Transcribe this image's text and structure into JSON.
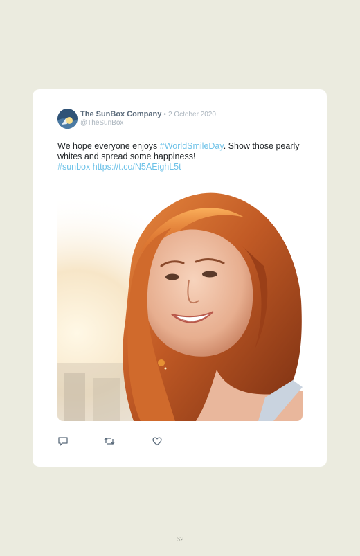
{
  "tweet": {
    "author_name": "The SunBox Company",
    "separator": "•",
    "date": "2 October 2020",
    "handle": "@TheSunBox",
    "text_part1": "We hope everyone enjoys ",
    "hashtag1": "#WorldSmileDay",
    "text_part2": ". Show those pearly whites and spread some happiness!",
    "hashtag2": "#sunbox",
    "link": "https://t.co/N5AEighL5t",
    "photo_icon": "smiling-woman-photo",
    "actions": [
      {
        "name": "reply",
        "icon": "speech-bubble-icon"
      },
      {
        "name": "retweet",
        "icon": "retweet-arrows-icon"
      },
      {
        "name": "like",
        "icon": "heart-icon"
      }
    ]
  },
  "page": {
    "number": "62"
  },
  "colors": {
    "background": "#ebebdf",
    "card": "#ffffff",
    "link": "#6ec2e8",
    "author": "#5b6b7b",
    "muted": "#aab4bd"
  }
}
